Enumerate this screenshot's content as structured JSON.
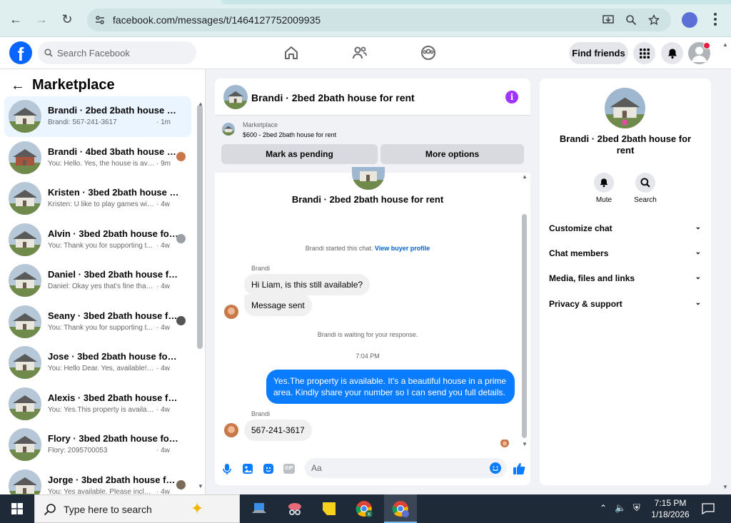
{
  "browser": {
    "url": "facebook.com/messages/t/1464127752009935"
  },
  "header": {
    "search_placeholder": "Search Facebook",
    "find_friends_label": "Find friends"
  },
  "sidebar": {
    "title": "Marketplace",
    "conversations": [
      {
        "title": "Brandi · 2bed 2bath house for r...",
        "snippet": "Brandi: 567-241-3617",
        "time": "· 1m",
        "active": true
      },
      {
        "title": "Brandi · 4bed 3bath house fo...",
        "snippet": "You: Hello. Yes, the house is ava...",
        "time": "· 9m"
      },
      {
        "title": "Kristen · 3bed 2bath house for r...",
        "snippet": "Kristen: U like to play games with ...",
        "time": "· 4w"
      },
      {
        "title": "Alvin · 3bed 2bath house for ...",
        "snippet": "You: Thank you for supporting t...",
        "time": "· 4w"
      },
      {
        "title": "Daniel · 3bed 2bath house for r...",
        "snippet": "Daniel: Okay yes that's fine thank ...",
        "time": "· 4w"
      },
      {
        "title": "Seany · 3bed 2bath house for...",
        "snippet": "You: Thank you for supporting t...",
        "time": "· 4w"
      },
      {
        "title": "Jose · 3bed 2bath house for rent.",
        "snippet": "You: Hello Dear. Yes, available! Ple...",
        "time": "· 4w"
      },
      {
        "title": "Alexis · 3bed 2bath house for re...",
        "snippet": "You: Yes.This property is available ...",
        "time": "· 4w"
      },
      {
        "title": "Flory · 3bed 2bath house for rent.",
        "snippet": "Flory: 2095700053",
        "time": "· 4w"
      },
      {
        "title": "Jorge · 3bed 2bath house for ...",
        "snippet": "You: Yes available. Please includ...",
        "time": "· 4w"
      }
    ]
  },
  "chat": {
    "title": "Brandi · 2bed 2bath house for rent",
    "marketplace_label": "Marketplace",
    "listing": "$600 - 2bed 2bath house for rent",
    "mark_pending": "Mark as pending",
    "more_options": "More options",
    "started_note": "Brandi started this chat.",
    "buyer_profile_link": "View buyer profile",
    "sender1": "Brandi",
    "msg1": "Hi Liam, is this still available?",
    "msg2": "Message sent",
    "waiting_note": "Brandi is waiting for your response.",
    "timestamp": "7:04 PM",
    "msg3": "Yes.The property is available. It's a beautiful house in a prime area. Kindly share your number so I can send you full details.",
    "sender2": "Brandi",
    "msg4": "567-241-3617",
    "input_placeholder": "Aa"
  },
  "details": {
    "name": "Brandi · 2bed 2bath house for rent",
    "mute_label": "Mute",
    "search_label": "Search",
    "sections": [
      "Customize chat",
      "Chat members",
      "Media, files and links",
      "Privacy & support"
    ]
  },
  "taskbar": {
    "search_placeholder": "Type here to search",
    "time": "7:15 PM",
    "date": "1/18/2026"
  },
  "colors": {
    "fb_blue": "#0866ff",
    "messenger_blue": "#0a7cff",
    "info_purple": "#a033ff"
  }
}
